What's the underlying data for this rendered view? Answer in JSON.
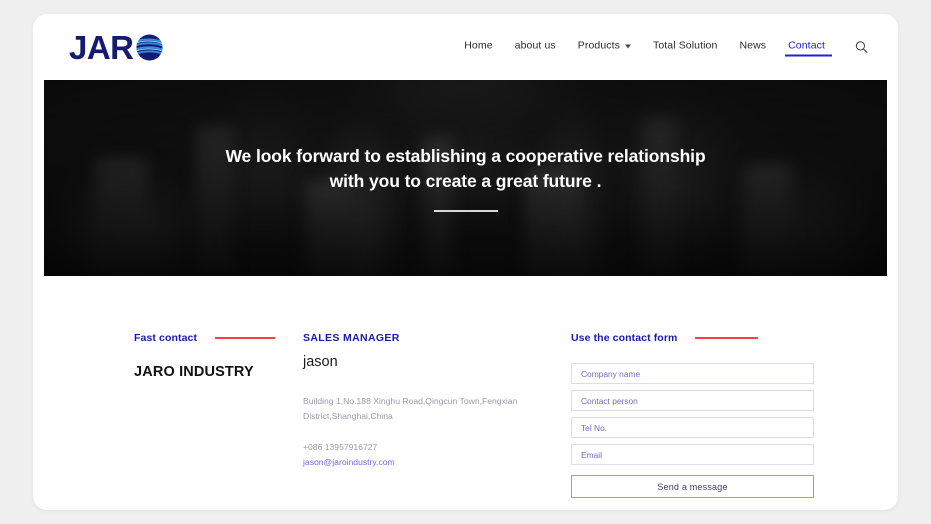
{
  "brand": {
    "logo_text": "JAR",
    "logo_globe_icon": "globe-icon",
    "navy": "#151b73",
    "accent_red": "#f0453f",
    "link_blue": "#2222cc"
  },
  "nav": {
    "items": [
      {
        "label": "Home",
        "active": false,
        "has_dropdown": false
      },
      {
        "label": "about us",
        "active": false,
        "has_dropdown": false
      },
      {
        "label": "Products",
        "active": false,
        "has_dropdown": true
      },
      {
        "label": "Total Solution",
        "active": false,
        "has_dropdown": false
      },
      {
        "label": "News",
        "active": false,
        "has_dropdown": false
      },
      {
        "label": "Contact",
        "active": true,
        "has_dropdown": false
      }
    ],
    "search_icon": "search-icon"
  },
  "hero": {
    "line1": "We look forward to establishing a cooperative relationship",
    "line2": "with you to create a great future ."
  },
  "fast_contact": {
    "title": "Fast contact",
    "company": "JARO INDUSTRY"
  },
  "sales_manager": {
    "title": "SALES MANAGER",
    "name": "jason",
    "address_line1": "Building 1,No.188 Xinghu Road,Qingcun Town,Fengxian",
    "address_line2": "District,Shanghai,China",
    "phone": "+086 13957916727",
    "email": "jason@jaroindustry.com"
  },
  "contact_form": {
    "title": "Use the contact form",
    "fields": [
      {
        "name": "company-name",
        "placeholder": "Company name",
        "value": ""
      },
      {
        "name": "contact-person",
        "placeholder": "Contact person",
        "value": ""
      },
      {
        "name": "tel-no",
        "placeholder": "Tel No.",
        "value": ""
      },
      {
        "name": "email",
        "placeholder": "Email",
        "value": ""
      }
    ],
    "submit_label": "Send a message"
  }
}
